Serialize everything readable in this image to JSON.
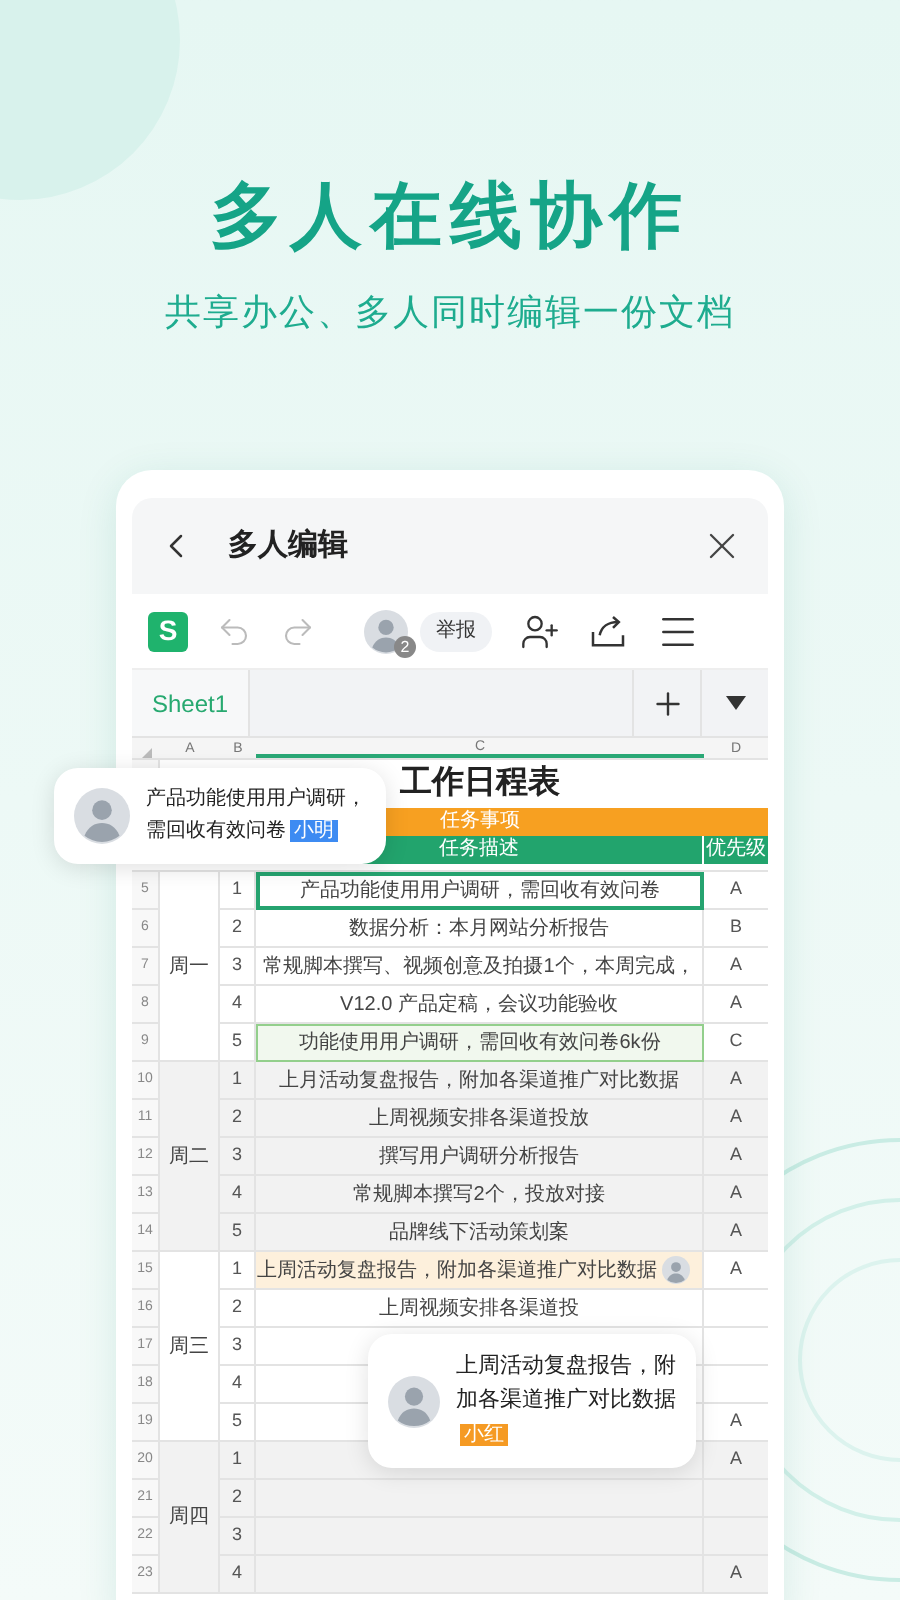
{
  "hero": {
    "title": "多人在线协作",
    "subtitle": "共享办公、多人同时编辑一份文档"
  },
  "editor": {
    "title": "多人编辑",
    "logo": "S",
    "collaborator_count": "2",
    "report_button": "举报",
    "sheet_tabs": [
      {
        "label": "Sheet1",
        "selected": true
      }
    ],
    "columns": [
      {
        "label": "A",
        "selected": false
      },
      {
        "label": "B",
        "selected": false
      },
      {
        "label": "C",
        "selected": true
      },
      {
        "label": "D",
        "selected": false
      }
    ],
    "sheet": {
      "title": "工作日程表",
      "section": "任务事项",
      "headers": [
        "任务描述",
        "优先级"
      ],
      "groups": [
        {
          "day": "周一",
          "shaded": false,
          "rows": [
            {
              "row": "5",
              "index": "1",
              "task": "产品功能使用用户调研，需回收有效问卷",
              "priority": "A",
              "kind": "selected"
            },
            {
              "row": "6",
              "index": "2",
              "task": "数据分析：本月网站分析报告",
              "priority": "B",
              "kind": "normal"
            },
            {
              "row": "7",
              "index": "3",
              "task": "常规脚本撰写、视频创意及拍摄1个，本周完成，",
              "priority": "A",
              "kind": "normal"
            },
            {
              "row": "8",
              "index": "4",
              "task": "V12.0 产品定稿，会议功能验收",
              "priority": "A",
              "kind": "normal"
            },
            {
              "row": "9",
              "index": "5",
              "task": "功能使用用户调研，需回收有效问卷6k份",
              "priority": "C",
              "kind": "done"
            }
          ]
        },
        {
          "day": "周二",
          "shaded": true,
          "rows": [
            {
              "row": "10",
              "index": "1",
              "task": "上月活动复盘报告，附加各渠道推广对比数据",
              "priority": "A",
              "kind": "normal"
            },
            {
              "row": "11",
              "index": "2",
              "task": "上周视频安排各渠道投放",
              "priority": "A",
              "kind": "normal"
            },
            {
              "row": "12",
              "index": "3",
              "task": "撰写用户调研分析报告",
              "priority": "A",
              "kind": "normal"
            },
            {
              "row": "13",
              "index": "4",
              "task": "常规脚本撰写2个，投放对接",
              "priority": "A",
              "kind": "normal"
            },
            {
              "row": "14",
              "index": "5",
              "task": "品牌线下活动策划案",
              "priority": "A",
              "kind": "normal"
            }
          ]
        },
        {
          "day": "周三",
          "shaded": false,
          "rows": [
            {
              "row": "15",
              "index": "1",
              "task": "上周活动复盘报告，附加各渠道推广对比数据",
              "priority": "A",
              "kind": "commented"
            },
            {
              "row": "16",
              "index": "2",
              "task": "上周视频安排各渠道投",
              "kind": "normal"
            },
            {
              "row": "17",
              "index": "3",
              "kind": "normal"
            },
            {
              "row": "18",
              "index": "4",
              "kind": "normal"
            },
            {
              "row": "19",
              "index": "5",
              "priority": "A",
              "kind": "normal"
            }
          ]
        },
        {
          "day": "周四",
          "shaded": true,
          "rows": [
            {
              "row": "20",
              "index": "1",
              "priority": "A",
              "kind": "normal"
            },
            {
              "row": "21",
              "index": "2",
              "kind": "normal"
            },
            {
              "row": "22",
              "index": "3",
              "kind": "normal"
            },
            {
              "row": "23",
              "index": "4",
              "priority": "A",
              "kind": "normal"
            }
          ]
        }
      ]
    }
  },
  "comments": [
    {
      "text": "产品功能使用用户调研，需回收有效问卷",
      "author": "小明",
      "color": "#3d8bf2"
    },
    {
      "text": "上周活动复盘报告，附加各渠道推广对比数据",
      "author": "小红",
      "color": "#f59a23"
    }
  ]
}
